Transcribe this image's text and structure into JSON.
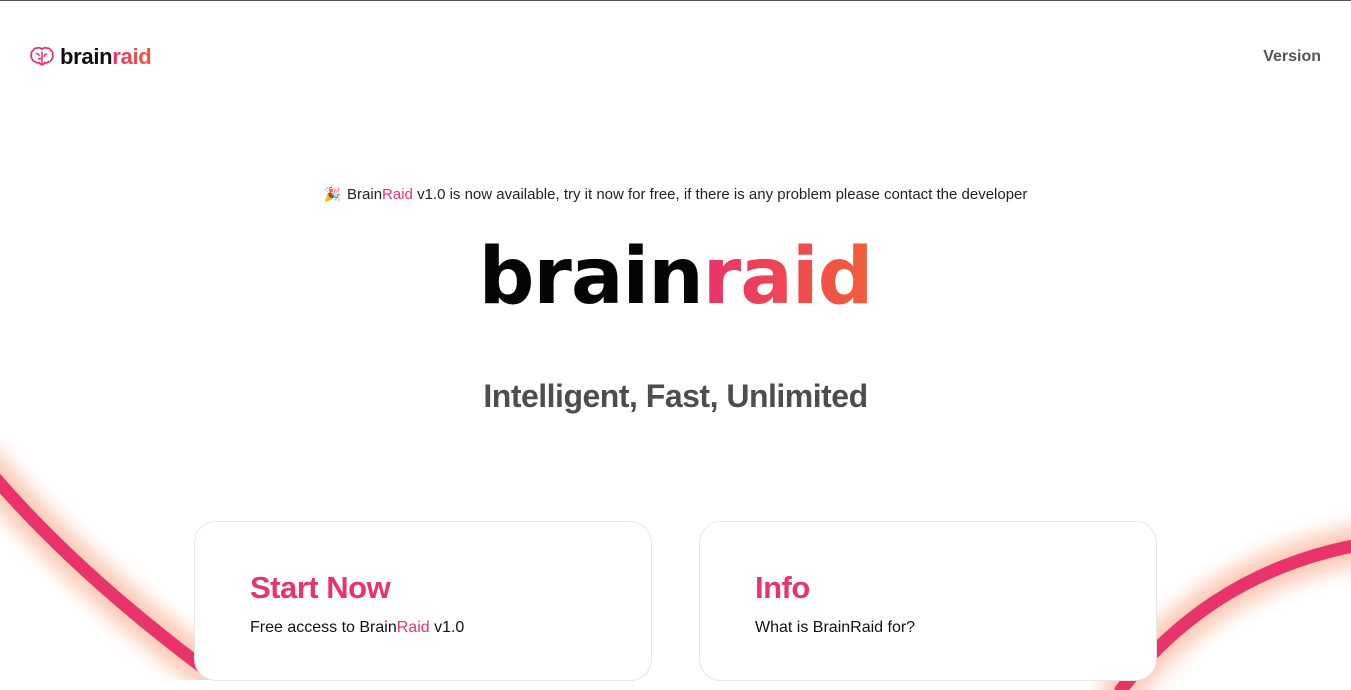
{
  "nav": {
    "logo_part1": "brain",
    "logo_part2": "raid",
    "version_label": "Version"
  },
  "announcement": {
    "icon": "party-popper-icon",
    "brand_part1": "Brain",
    "brand_part2": "Raid",
    "text": " v1.0 is now available, try it now for free, if there is any problem please contact the developer"
  },
  "hero": {
    "title_part1": "brain",
    "title_part2": "raid",
    "tagline": "Intelligent, Fast, Unlimited"
  },
  "cards": {
    "start": {
      "title": "Start Now",
      "text_prefix": "Free access to Brain",
      "text_brand": "Raid",
      "text_suffix": " v1.0"
    },
    "info": {
      "title": "Info",
      "text": "What is BrainRaid for?"
    }
  },
  "colors": {
    "accent": "#e8336b",
    "accent_orange": "#f0603a",
    "text_dark": "#111111",
    "text_muted": "#4d4d4d"
  }
}
